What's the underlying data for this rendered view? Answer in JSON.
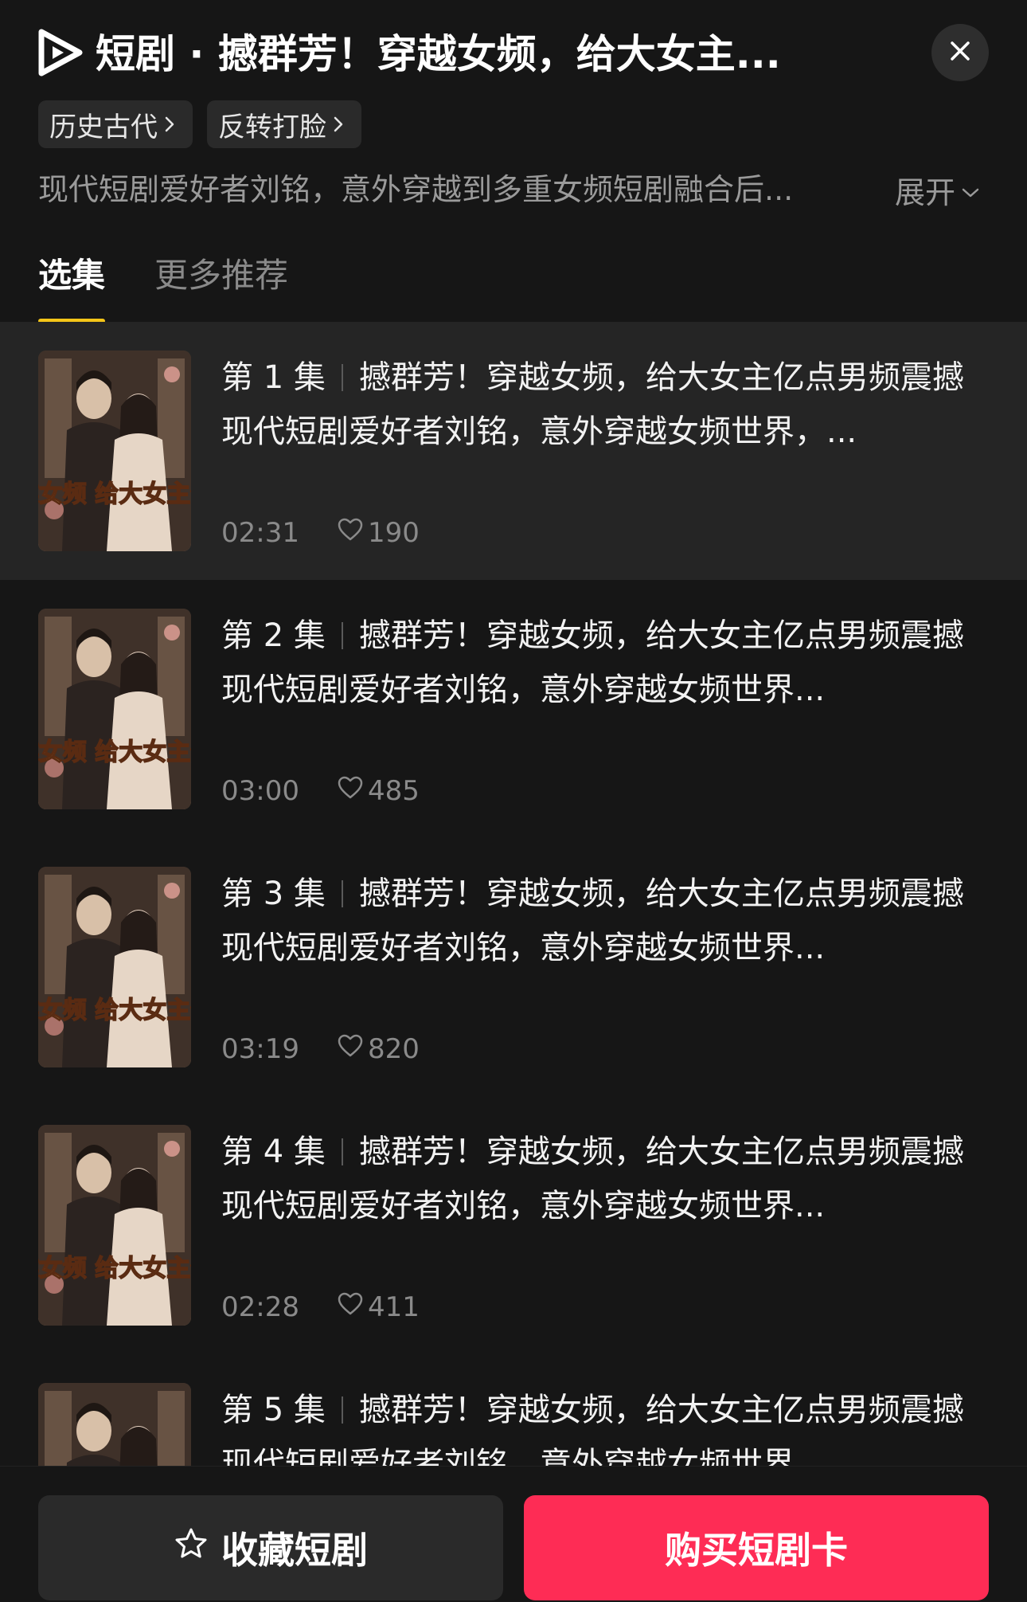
{
  "header": {
    "title": "短剧 · 撼群芳！穿越女频，给大女主...",
    "tags": [
      {
        "label": "历史古代"
      },
      {
        "label": "反转打脸"
      }
    ],
    "description": "现代短剧爱好者刘铭，意外穿越到多重女频短剧融合后...",
    "expand_label": "展开"
  },
  "tabs": [
    {
      "label": "选集",
      "active": true
    },
    {
      "label": "更多推荐",
      "active": false
    }
  ],
  "episodes": [
    {
      "number": "第 1 集",
      "title": "撼群芳！穿越女频，给大女主亿点男频震撼 现代短剧爱好者刘铭，意外穿越女频世界，...",
      "duration": "02:31",
      "likes": "190",
      "selected": true
    },
    {
      "number": "第 2 集",
      "title": "撼群芳！穿越女频，给大女主亿点男频震撼 现代短剧爱好者刘铭，意外穿越女频世界...",
      "duration": "03:00",
      "likes": "485",
      "selected": false
    },
    {
      "number": "第 3 集",
      "title": "撼群芳！穿越女频，给大女主亿点男频震撼 现代短剧爱好者刘铭，意外穿越女频世界...",
      "duration": "03:19",
      "likes": "820",
      "selected": false
    },
    {
      "number": "第 4 集",
      "title": "撼群芳！穿越女频，给大女主亿点男频震撼 现代短剧爱好者刘铭，意外穿越女频世界...",
      "duration": "02:28",
      "likes": "411",
      "selected": false
    },
    {
      "number": "第 5 集",
      "title": "撼群芳！穿越女频，给大女主亿点男频震撼 现代短剧爱好者刘铭，意外穿越女频世界...",
      "duration": "",
      "likes": "",
      "selected": false
    }
  ],
  "thumbnail_text": "撼群芳！穿越女频 给大女主亿点男频震撼",
  "bottom": {
    "favorite_label": "收藏短剧",
    "buy_label": "购买短剧卡"
  },
  "colors": {
    "background": "#161616",
    "accent_tab_underline": "#f5c518",
    "buy_button": "#fe2c55",
    "muted_text": "#8a8a8a"
  },
  "icons": [
    "app-logo-icon",
    "close-icon",
    "chevron-right-icon",
    "chevron-down-icon",
    "heart-icon",
    "star-icon"
  ]
}
